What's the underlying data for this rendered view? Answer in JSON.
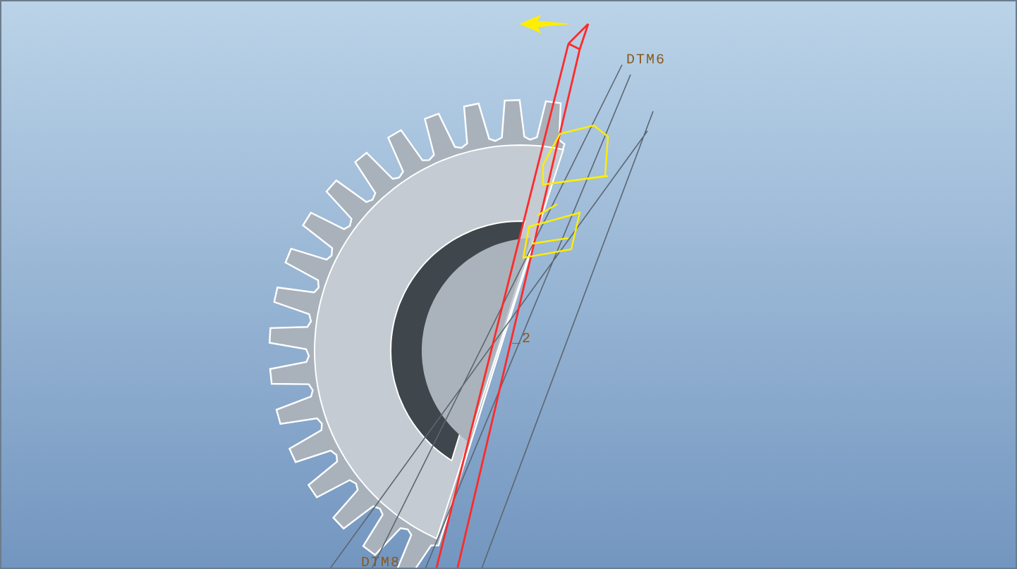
{
  "viewport": {
    "datum_labels": [
      {
        "text": "DTM6"
      },
      {
        "text": "_2"
      },
      {
        "text": "DTM8"
      }
    ]
  }
}
